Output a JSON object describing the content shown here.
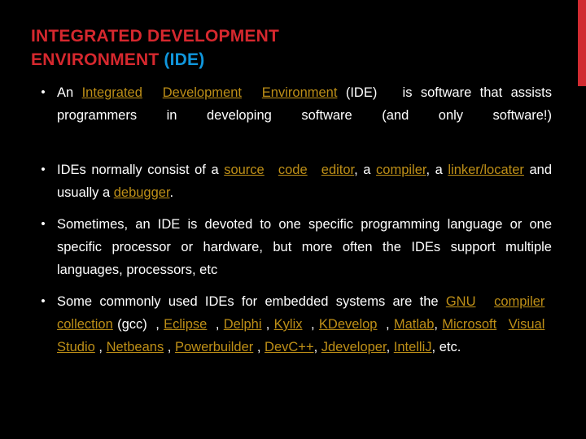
{
  "slide": {
    "background_color": "#000000",
    "accent_bar_color": "#D12B31",
    "title": {
      "line1": "INTEGRATED DEVELOPMENT",
      "line2_main": "ENVIRONMENT",
      "line2_accent": "(IDE)",
      "color": "#D6282E",
      "accent_color": "#1097DD"
    },
    "link_color": "#BE8F17",
    "text_color": "#FFFFFF",
    "bullet_marker": "•",
    "bullets": [
      {
        "id": "bullet-definition",
        "segments": [
          {
            "text": "An ",
            "link": false
          },
          {
            "text": "Integrated ",
            "link": true
          },
          {
            "text": " ",
            "link": false
          },
          {
            "text": "Development ",
            "link": true
          },
          {
            "text": " ",
            "link": false
          },
          {
            "text": "Environment",
            "link": true
          },
          {
            "text": " (IDE)   is software that assists programmers in developing software (and only software!)",
            "link": false
          }
        ],
        "plain": "An Integrated  Development  Environment (IDE)   is software that assists programmers in developing software (and only software!)"
      },
      {
        "id": "bullet-components",
        "segments": [
          {
            "text": "IDEs normally consist of a ",
            "link": false
          },
          {
            "text": "source ",
            "link": true
          },
          {
            "text": " ",
            "link": false
          },
          {
            "text": "code ",
            "link": true
          },
          {
            "text": " ",
            "link": false
          },
          {
            "text": "editor",
            "link": true
          },
          {
            "text": ", a ",
            "link": false
          },
          {
            "text": "compiler",
            "link": true
          },
          {
            "text": ", a ",
            "link": false
          },
          {
            "text": "linker/locater",
            "link": true
          },
          {
            "text": " and usually a ",
            "link": false
          },
          {
            "text": "debugger",
            "link": true
          },
          {
            "text": ".",
            "link": false
          }
        ],
        "plain": "IDEs normally consist of a source  code  editor, a compiler, a linker/locater and usually a debugger."
      },
      {
        "id": "bullet-language-specific",
        "segments": [
          {
            "text": "Sometimes, an IDE is devoted to one specific programming language or one specific processor or hardware, but more often the IDEs support multiple languages, processors, etc",
            "link": false
          }
        ],
        "plain": "Sometimes, an IDE is devoted to one specific programming language or one specific processor or hardware, but more often the IDEs support multiple languages, processors, etc"
      },
      {
        "id": "bullet-examples",
        "segments": [
          {
            "text": "Some commonly used IDEs for embedded systems are the ",
            "link": false
          },
          {
            "text": "GNU ",
            "link": true
          },
          {
            "text": " ",
            "link": false
          },
          {
            "text": "compiler ",
            "link": true
          },
          {
            "text": " ",
            "link": false
          },
          {
            "text": "collection",
            "link": true
          },
          {
            "text": " (gcc)  , ",
            "link": false
          },
          {
            "text": "Eclipse",
            "link": true
          },
          {
            "text": "  , ",
            "link": false
          },
          {
            "text": "Delphi",
            "link": true
          },
          {
            "text": " , ",
            "link": false
          },
          {
            "text": "Kylix",
            "link": true
          },
          {
            "text": "  , ",
            "link": false
          },
          {
            "text": "KDevelop",
            "link": true
          },
          {
            "text": "  , ",
            "link": false
          },
          {
            "text": "Matlab",
            "link": true
          },
          {
            "text": ", ",
            "link": false
          },
          {
            "text": "Microsoft ",
            "link": true
          },
          {
            "text": " ",
            "link": false
          },
          {
            "text": "Visual ",
            "link": true
          },
          {
            "text": " ",
            "link": false
          },
          {
            "text": "Studio",
            "link": true
          },
          {
            "text": " , ",
            "link": false
          },
          {
            "text": "Netbeans",
            "link": true
          },
          {
            "text": " , ",
            "link": false
          },
          {
            "text": "Powerbuilder",
            "link": true
          },
          {
            "text": " , ",
            "link": false
          },
          {
            "text": "DevC++",
            "link": true
          },
          {
            "text": ", ",
            "link": false
          },
          {
            "text": "Jdeveloper",
            "link": true
          },
          {
            "text": ", ",
            "link": false
          },
          {
            "text": "IntelliJ",
            "link": true
          },
          {
            "text": ", etc.",
            "link": false
          }
        ],
        "plain": "Some commonly used IDEs for embedded systems are the GNU  compiler  collection (gcc)  , Eclipse  , Delphi , Kylix  , KDevelop  , Matlab, Microsoft  Visual  Studio , Netbeans , Powerbuilder , DevC++, Jdeveloper, IntelliJ, etc."
      }
    ]
  }
}
